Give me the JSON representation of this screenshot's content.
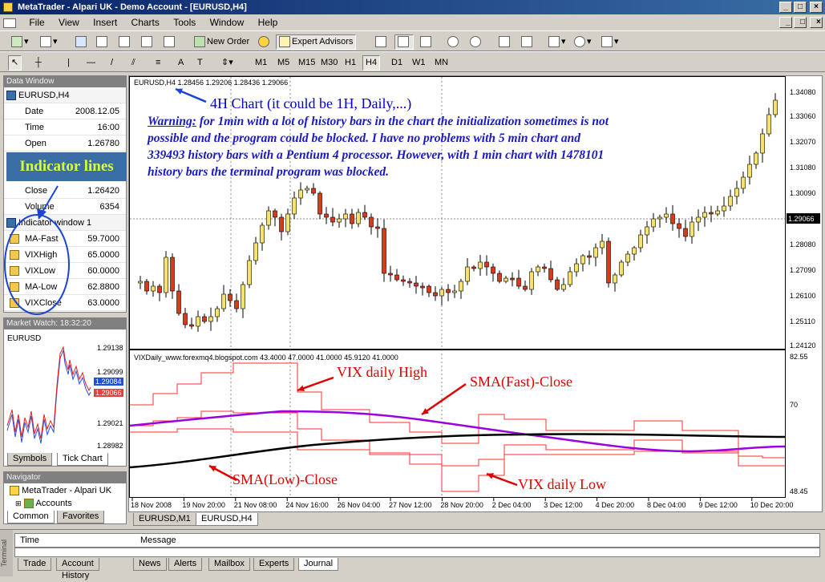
{
  "window": {
    "title": "MetaTrader - Alpari UK - Demo Account - [EURUSD,H4]"
  },
  "menu": [
    "File",
    "View",
    "Insert",
    "Charts",
    "Tools",
    "Window",
    "Help"
  ],
  "toolbar": {
    "new_order": "New Order",
    "expert_advisors": "Expert Advisors",
    "timeframes": [
      "M1",
      "M5",
      "M15",
      "M30",
      "H1",
      "H4",
      "D1",
      "W1",
      "MN"
    ]
  },
  "data_window": {
    "title": "Data Window",
    "symbol": "EURUSD,H4",
    "rows": [
      {
        "label": "Date",
        "value": "2008.12.05"
      },
      {
        "label": "Time",
        "value": "16:00"
      },
      {
        "label": "Open",
        "value": "1.26780"
      }
    ],
    "rows2": [
      {
        "label": "Close",
        "value": "1.26420"
      },
      {
        "label": "Volume",
        "value": "6354"
      }
    ],
    "indicator_window": "Indicator window 1",
    "indicators": [
      {
        "label": "MA-Fast",
        "value": "59.7000"
      },
      {
        "label": "VIXHigh",
        "value": "65.0000"
      },
      {
        "label": "VIXLow",
        "value": "60.0000"
      },
      {
        "label": "MA-Low",
        "value": "62.8800"
      },
      {
        "label": "VIXClose",
        "value": "63.0000"
      }
    ]
  },
  "market_watch": {
    "title": "Market Watch: 18:32:20",
    "symbol": "EURUSD",
    "prices": [
      "1.29138",
      "1.29099",
      "1.29084",
      "1.29066",
      "1.29021",
      "1.28982"
    ],
    "tabs": [
      "Symbols",
      "Tick Chart"
    ]
  },
  "navigator": {
    "title": "Navigator",
    "root": "MetaTrader - Alpari UK",
    "child": "Accounts",
    "tabs": [
      "Common",
      "Favorites"
    ]
  },
  "chart": {
    "header": "EURUSD,H4  1.28456  1.29206  1.28436  1.29066",
    "price_labels": [
      "1.34080",
      "1.33060",
      "1.32070",
      "1.31080",
      "1.30090",
      "1.29066",
      "1.28080",
      "1.27090",
      "1.26100",
      "1.25110",
      "1.24120"
    ],
    "current_price": "1.29066",
    "indicator_header": "VIXDaily_www.forexmq4.blogspot.com  43.4000  47.0000  41.0000  45.9120  41.0000",
    "indicator_labels": [
      "82.55",
      "70",
      "48.45"
    ],
    "time_labels": [
      "18 Nov 2008",
      "19 Nov 20:00",
      "21 Nov 08:00",
      "24 Nov 16:00",
      "26 Nov 04:00",
      "27 Nov 12:00",
      "28 Nov 20:00",
      "2 Dec 04:00",
      "3 Dec 12:00",
      "4 Dec 20:00",
      "8 Dec 04:00",
      "9 Dec 12:00",
      "10 Dec 20:00"
    ],
    "tabs": [
      "EURUSD,M1",
      "EURUSD,H4"
    ]
  },
  "annotations": {
    "indicator_lines": "Indicator lines",
    "chart_type": "4H Chart (it could be 1H, Daily,...)",
    "warning_label": "Warning:",
    "warning_text": [
      " for 1min with a lot of history bars in the chart the initialization sometimes is not",
      "possible and the program could be blocked. I have no problems with 5 min chart and",
      "339493 history bars with a Pentium 4 processor. However, with 1 min chart with 1478101",
      "history bars the terminal program was blocked."
    ],
    "vix_high": "VIX daily High",
    "sma_fast": "SMA(Fast)-Close",
    "sma_low": "SMA(Low)-Close",
    "vix_low": "VIX daily Low"
  },
  "terminal": {
    "cols": [
      "Time",
      "Message"
    ],
    "tabs": [
      "Trade",
      "Account History",
      "News",
      "Alerts",
      "Mailbox",
      "Experts",
      "Journal"
    ],
    "side": "Terminal"
  },
  "colors": {
    "title_start": "#0a246a",
    "bull": "#f7e26b",
    "bear": "#d93a1e",
    "annotation": "#0000cc",
    "arrow": "#e00000",
    "ma_fast": "#9b00e0",
    "ma_low": "#000000",
    "vix": "#ff3030"
  }
}
